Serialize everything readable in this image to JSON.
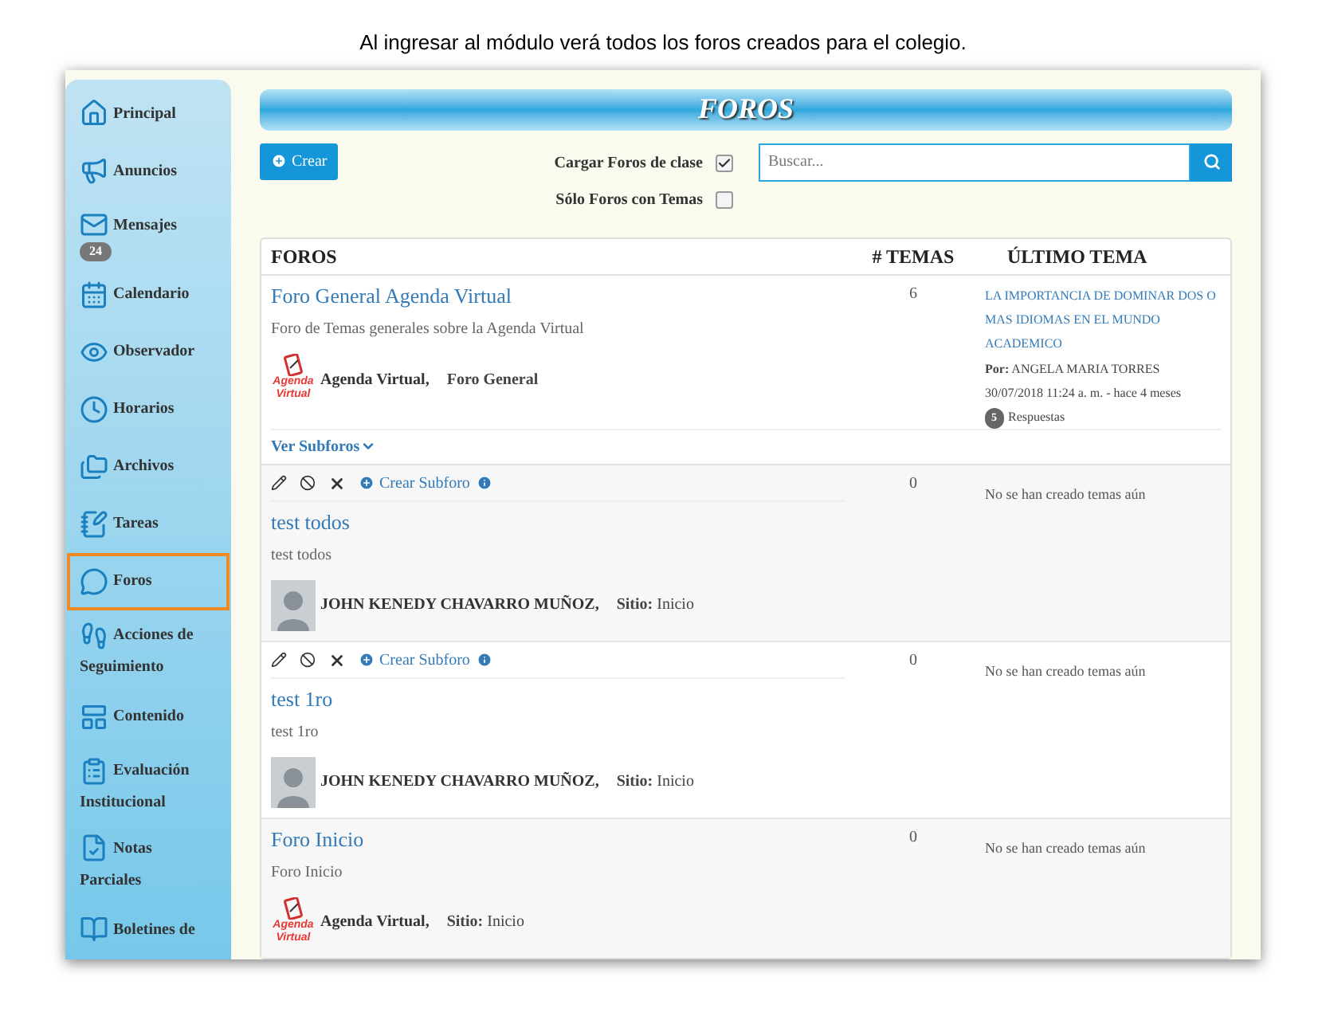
{
  "caption": "Al ingresar al módulo verá todos los foros creados para el colegio.",
  "sidebar": {
    "items": [
      {
        "label": "Principal",
        "selected": false
      },
      {
        "label": "Anuncios",
        "selected": false
      },
      {
        "label": "Mensajes",
        "badge": "24",
        "selected": false
      },
      {
        "label": "Calendario",
        "selected": false
      },
      {
        "label": "Observador",
        "selected": false
      },
      {
        "label": "Horarios",
        "selected": false
      },
      {
        "label": "Archivos",
        "selected": false
      },
      {
        "label": "Tareas",
        "selected": false
      },
      {
        "label": "Foros",
        "selected": true
      },
      {
        "label": "Acciones de Seguimiento",
        "selected": false
      },
      {
        "label": "Contenido",
        "selected": false
      },
      {
        "label": "Evaluación Institucional",
        "selected": false
      },
      {
        "label": "Notas Parciales",
        "selected": false
      },
      {
        "label": "Boletines de",
        "selected": false
      }
    ]
  },
  "header": {
    "title": "FOROS"
  },
  "toolbar": {
    "create_button": "Crear",
    "checkboxes": [
      {
        "label": "Cargar Foros de clase",
        "checked": true
      },
      {
        "label": "Sólo Foros con Temas",
        "checked": false
      }
    ],
    "search": {
      "placeholder": "Buscar..."
    }
  },
  "table": {
    "columns": [
      "FOROS",
      "# TEMAS",
      "ÚLTIMO TEMA"
    ],
    "rows": [
      {
        "kind": "main",
        "title": "Foro General Agenda Virtual",
        "description": "Foro de Temas generales sobre la Agenda Virtual",
        "avatar": {
          "kind": "logo",
          "lines": [
            "Agenda",
            "Virtual"
          ]
        },
        "author": "Agenda Virtual,",
        "meta": "**Foro General**",
        "topics": "6",
        "last_topic": {
          "title": "LA IMPORTANCIA DE DOMINAR DOS O MAS IDIOMAS EN EL MUNDO ACADEMICO",
          "by": "**Por:** ANGELA MARIA TORRES",
          "date": "30/07/2018 11:24 a. m. - hace 4 meses",
          "replies": "5",
          "replies_label": "Respuestas"
        },
        "subforums_link": "Ver Subforos"
      },
      {
        "kind": "subforum",
        "create_subforum": "Crear Subforo",
        "title": "test todos",
        "description": "test todos",
        "avatar": {
          "kind": "photo"
        },
        "author": "JOHN KENEDY CHAVARRO MUÑOZ,",
        "meta": "**Sitio:** Inicio",
        "topics": "0",
        "empty_text": "No se han creado temas aún"
      },
      {
        "kind": "subforum",
        "create_subforum": "Crear Subforo",
        "title": "test 1ro",
        "description": "test 1ro",
        "avatar": {
          "kind": "photo"
        },
        "author": "JOHN KENEDY CHAVARRO MUÑOZ,",
        "meta": "**Sitio:** Inicio",
        "topics": "0",
        "empty_text": "No se han creado temas aún"
      },
      {
        "kind": "plain",
        "title": "Foro Inicio",
        "description": "Foro Inicio",
        "avatar": {
          "kind": "logo",
          "lines": [
            "Agenda",
            "Virtual"
          ]
        },
        "author": "Agenda Virtual,",
        "meta": "**Sitio:** Inicio",
        "topics": "0",
        "empty_text": "No se han creado temas aún"
      }
    ]
  }
}
